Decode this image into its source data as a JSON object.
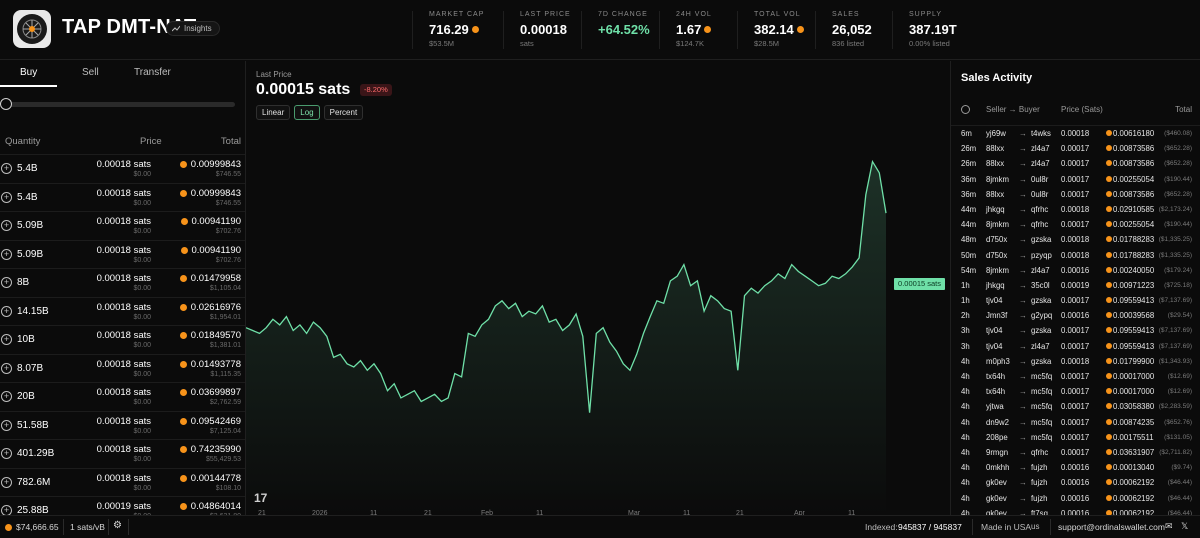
{
  "header": {
    "title": "TAP DMT-NAT",
    "insights_label": "Insights",
    "stats": [
      {
        "label": "MARKET CAP",
        "value": "716.29",
        "coin": true,
        "sub": "$53.5M"
      },
      {
        "label": "LAST PRICE",
        "value": "0.00018",
        "coin": false,
        "sub": "sats"
      },
      {
        "label": "7D CHANGE",
        "value": "+64.52%",
        "coin": false,
        "sub": ""
      },
      {
        "label": "24H VOL",
        "value": "1.67",
        "coin": true,
        "sub": "$124.7K"
      },
      {
        "label": "TOTAL VOL",
        "value": "382.14",
        "coin": true,
        "sub": "$28.5M"
      },
      {
        "label": "SALES",
        "value": "26,052",
        "coin": false,
        "sub": "836 listed"
      },
      {
        "label": "SUPPLY",
        "value": "387.19T",
        "coin": false,
        "sub": "0.00% listed"
      }
    ]
  },
  "left": {
    "tabs": [
      "Buy",
      "Sell",
      "Transfer"
    ],
    "columns": [
      "Quantity",
      "Price",
      "Total"
    ],
    "rows": [
      {
        "qty": "5.4B",
        "price": "0.00018 sats",
        "price_usd": "$0.00",
        "total": "0.00999843",
        "total_usd": "$746.55"
      },
      {
        "qty": "5.4B",
        "price": "0.00018 sats",
        "price_usd": "$0.00",
        "total": "0.00999843",
        "total_usd": "$746.55"
      },
      {
        "qty": "5.09B",
        "price": "0.00018 sats",
        "price_usd": "$0.00",
        "total": "0.00941190",
        "total_usd": "$702.76"
      },
      {
        "qty": "5.09B",
        "price": "0.00018 sats",
        "price_usd": "$0.00",
        "total": "0.00941190",
        "total_usd": "$702.76"
      },
      {
        "qty": "8B",
        "price": "0.00018 sats",
        "price_usd": "$0.00",
        "total": "0.01479958",
        "total_usd": "$1,105.04"
      },
      {
        "qty": "14.15B",
        "price": "0.00018 sats",
        "price_usd": "$0.00",
        "total": "0.02616976",
        "total_usd": "$1,954.01"
      },
      {
        "qty": "10B",
        "price": "0.00018 sats",
        "price_usd": "$0.00",
        "total": "0.01849570",
        "total_usd": "$1,381.01"
      },
      {
        "qty": "8.07B",
        "price": "0.00018 sats",
        "price_usd": "$0.00",
        "total": "0.01493778",
        "total_usd": "$1,115.35"
      },
      {
        "qty": "20B",
        "price": "0.00018 sats",
        "price_usd": "$0.00",
        "total": "0.03699897",
        "total_usd": "$2,762.59"
      },
      {
        "qty": "51.58B",
        "price": "0.00018 sats",
        "price_usd": "$0.00",
        "total": "0.09542469",
        "total_usd": "$7,125.04"
      },
      {
        "qty": "401.29B",
        "price": "0.00018 sats",
        "price_usd": "$0.00",
        "total": "0.74235990",
        "total_usd": "$55,429.53"
      },
      {
        "qty": "782.6M",
        "price": "0.00018 sats",
        "price_usd": "$0.00",
        "total": "0.00144778",
        "total_usd": "$108.10"
      },
      {
        "qty": "25.88B",
        "price": "0.00019 sats",
        "price_usd": "$0.00",
        "total": "0.04864014",
        "total_usd": "$3,631.80"
      }
    ]
  },
  "center": {
    "last_price_label": "Last Price",
    "last_price": "0.00015 sats",
    "change": "-8.20%",
    "scale_buttons": [
      "Linear",
      "Log",
      "Percent"
    ],
    "active_scale": "Log",
    "price_tag": "0.00015 sats",
    "x_labels": [
      "21",
      "2026",
      "11",
      "21",
      "Feb",
      "11",
      "Mar",
      "11",
      "21",
      "Apr",
      "11"
    ],
    "accent": "#6fe0a8"
  },
  "chart_data": {
    "type": "area",
    "title": "",
    "xlabel": "",
    "ylabel": "",
    "y_scale": "log",
    "grid": false,
    "series": [
      {
        "values": [
          0.0001,
          9.9e-05,
          9.8e-05,
          0.0001,
          0.000103,
          0.000101,
          0.000104,
          9.9e-05,
          0.000101,
          9.8e-05,
          0.000102,
          0.0001,
          9.7e-05,
          9e-05,
          9.1e-05,
          8.8e-05,
          8.7e-05,
          8.9e-05,
          8.6e-05,
          8.8e-05,
          8.5e-05,
          8e-05,
          8.2e-05,
          7.8e-05,
          7.9e-05,
          8e-05,
          7.7e-05,
          7.8e-05,
          7.9e-05,
          7.7e-05,
          7.8e-05,
          8.5e-05,
          8.4e-05,
          9.8e-05,
          9.7e-05,
          0.000101,
          0.000103,
          0.000108,
          0.00011,
          0.000107,
          0.000109,
          0.000104,
          0.000106,
          0.000105,
          0.000108,
          0.000102,
          0.000103,
          9.9e-05,
          0.000101,
          0.000105,
          9.7e-05,
          7.4e-05,
          9.8e-05,
          0.0001,
          9.5e-05,
          9.2e-05,
          8.8e-05,
          8.6e-05,
          9.1e-05,
          9.8e-05,
          0.000104,
          0.00011,
          0.000109,
          0.000118,
          0.00012,
          0.000125,
          0.000116,
          0.000118,
          0.000106,
          0.000112,
          0.00011,
          0.000107,
          0.000106,
          8.6e-05,
          0.000112,
          0.000115,
          0.000113,
          0.000116,
          0.000118,
          0.000121,
          0.000119,
          0.000125,
          0.000122,
          0.00012,
          0.000118,
          0.000116,
          0.000117,
          0.00012,
          0.000119,
          0.000121,
          0.000124,
          0.000128,
          0.00016,
          0.00018,
          0.000173,
          0.00015
        ]
      }
    ]
  },
  "right": {
    "title": "Sales Activity",
    "columns": [
      "Seller → Buyer",
      "Price (Sats)",
      "Total"
    ],
    "rows": [
      {
        "t": "6m",
        "seller": "yj69w",
        "buyer": "t4wks",
        "price": "0.00018",
        "total": "0.00616180",
        "usd": "($460.08)"
      },
      {
        "t": "26m",
        "seller": "88lxx",
        "buyer": "zl4a7",
        "price": "0.00017",
        "total": "0.00873586",
        "usd": "($652.28)"
      },
      {
        "t": "26m",
        "seller": "88lxx",
        "buyer": "zl4a7",
        "price": "0.00017",
        "total": "0.00873586",
        "usd": "($652.28)"
      },
      {
        "t": "36m",
        "seller": "8jmkm",
        "buyer": "0ul8r",
        "price": "0.00017",
        "total": "0.00255054",
        "usd": "($190.44)"
      },
      {
        "t": "36m",
        "seller": "88lxx",
        "buyer": "0ul8r",
        "price": "0.00017",
        "total": "0.00873586",
        "usd": "($652.28)"
      },
      {
        "t": "44m",
        "seller": "jhkgq",
        "buyer": "qfrhc",
        "price": "0.00018",
        "total": "0.02910585",
        "usd": "($2,173.24)"
      },
      {
        "t": "44m",
        "seller": "8jmkm",
        "buyer": "qfrhc",
        "price": "0.00017",
        "total": "0.00255054",
        "usd": "($190.44)"
      },
      {
        "t": "48m",
        "seller": "d750x",
        "buyer": "gzska",
        "price": "0.00018",
        "total": "0.01788283",
        "usd": "($1,335.25)"
      },
      {
        "t": "50m",
        "seller": "d750x",
        "buyer": "pzyqp",
        "price": "0.00018",
        "total": "0.01788283",
        "usd": "($1,335.25)"
      },
      {
        "t": "54m",
        "seller": "8jmkm",
        "buyer": "zl4a7",
        "price": "0.00016",
        "total": "0.00240050",
        "usd": "($179.24)"
      },
      {
        "t": "1h",
        "seller": "jhkgq",
        "buyer": "35c0l",
        "price": "0.00019",
        "total": "0.00971223",
        "usd": "($725.18)"
      },
      {
        "t": "1h",
        "seller": "tjv04",
        "buyer": "gzska",
        "price": "0.00017",
        "total": "0.09559413",
        "usd": "($7,137.69)"
      },
      {
        "t": "2h",
        "seller": "Jmn3f",
        "buyer": "g2ypq",
        "price": "0.00016",
        "total": "0.00039568",
        "usd": "($29.54)"
      },
      {
        "t": "3h",
        "seller": "tjv04",
        "buyer": "gzska",
        "price": "0.00017",
        "total": "0.09559413",
        "usd": "($7,137.69)"
      },
      {
        "t": "3h",
        "seller": "tjv04",
        "buyer": "zl4a7",
        "price": "0.00017",
        "total": "0.09559413",
        "usd": "($7,137.69)"
      },
      {
        "t": "4h",
        "seller": "m0ph3",
        "buyer": "gzska",
        "price": "0.00018",
        "total": "0.01799900",
        "usd": "($1,343.93)"
      },
      {
        "t": "4h",
        "seller": "tx64h",
        "buyer": "mc5fq",
        "price": "0.00017",
        "total": "0.00017000",
        "usd": "($12.69)"
      },
      {
        "t": "4h",
        "seller": "tx64h",
        "buyer": "mc5fq",
        "price": "0.00017",
        "total": "0.00017000",
        "usd": "($12.69)"
      },
      {
        "t": "4h",
        "seller": "yjtwa",
        "buyer": "mc5fq",
        "price": "0.00017",
        "total": "0.03058380",
        "usd": "($2,283.59)"
      },
      {
        "t": "4h",
        "seller": "dn9w2",
        "buyer": "mc5fq",
        "price": "0.00017",
        "total": "0.00874235",
        "usd": "($652.76)"
      },
      {
        "t": "4h",
        "seller": "208pe",
        "buyer": "mc5fq",
        "price": "0.00017",
        "total": "0.00175511",
        "usd": "($131.05)"
      },
      {
        "t": "4h",
        "seller": "9rmgn",
        "buyer": "qfrhc",
        "price": "0.00017",
        "total": "0.03631907",
        "usd": "($2,711.82)"
      },
      {
        "t": "4h",
        "seller": "0mkhh",
        "buyer": "fujzh",
        "price": "0.00016",
        "total": "0.00013040",
        "usd": "($9.74)"
      },
      {
        "t": "4h",
        "seller": "gk0ev",
        "buyer": "fujzh",
        "price": "0.00016",
        "total": "0.00062192",
        "usd": "($46.44)"
      },
      {
        "t": "4h",
        "seller": "gk0ev",
        "buyer": "fujzh",
        "price": "0.00016",
        "total": "0.00062192",
        "usd": "($46.44)"
      },
      {
        "t": "4h",
        "seller": "gk0ev",
        "buyer": "ft7sq",
        "price": "0.00016",
        "total": "0.00062192",
        "usd": "($46.44)"
      }
    ]
  },
  "footer": {
    "btc_price": "$74,666.65",
    "fee": "1 sats/vB",
    "indexed_label": "Indexed:",
    "indexed": "945837 / 945837",
    "made_in": "Made in USA",
    "support": "support@ordinalswallet.com"
  }
}
